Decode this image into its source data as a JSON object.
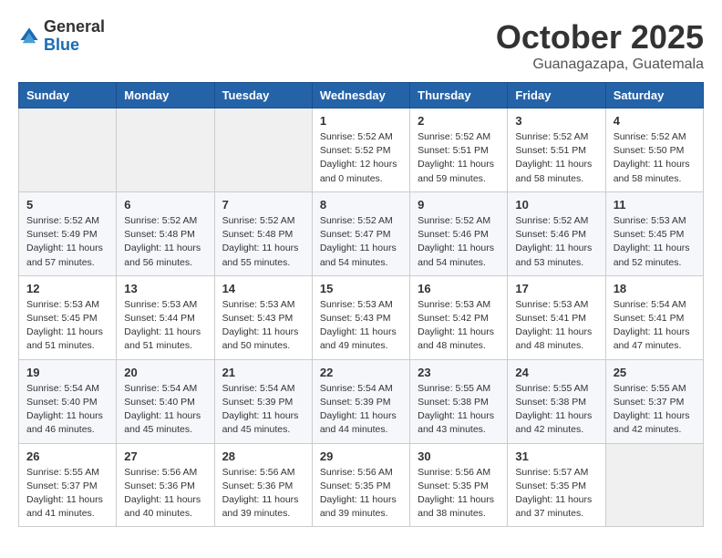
{
  "logo": {
    "general": "General",
    "blue": "Blue"
  },
  "title": "October 2025",
  "location": "Guanagazapa, Guatemala",
  "weekdays": [
    "Sunday",
    "Monday",
    "Tuesday",
    "Wednesday",
    "Thursday",
    "Friday",
    "Saturday"
  ],
  "weeks": [
    [
      {
        "day": "",
        "info": ""
      },
      {
        "day": "",
        "info": ""
      },
      {
        "day": "",
        "info": ""
      },
      {
        "day": "1",
        "info": "Sunrise: 5:52 AM\nSunset: 5:52 PM\nDaylight: 12 hours\nand 0 minutes."
      },
      {
        "day": "2",
        "info": "Sunrise: 5:52 AM\nSunset: 5:51 PM\nDaylight: 11 hours\nand 59 minutes."
      },
      {
        "day": "3",
        "info": "Sunrise: 5:52 AM\nSunset: 5:51 PM\nDaylight: 11 hours\nand 58 minutes."
      },
      {
        "day": "4",
        "info": "Sunrise: 5:52 AM\nSunset: 5:50 PM\nDaylight: 11 hours\nand 58 minutes."
      }
    ],
    [
      {
        "day": "5",
        "info": "Sunrise: 5:52 AM\nSunset: 5:49 PM\nDaylight: 11 hours\nand 57 minutes."
      },
      {
        "day": "6",
        "info": "Sunrise: 5:52 AM\nSunset: 5:48 PM\nDaylight: 11 hours\nand 56 minutes."
      },
      {
        "day": "7",
        "info": "Sunrise: 5:52 AM\nSunset: 5:48 PM\nDaylight: 11 hours\nand 55 minutes."
      },
      {
        "day": "8",
        "info": "Sunrise: 5:52 AM\nSunset: 5:47 PM\nDaylight: 11 hours\nand 54 minutes."
      },
      {
        "day": "9",
        "info": "Sunrise: 5:52 AM\nSunset: 5:46 PM\nDaylight: 11 hours\nand 54 minutes."
      },
      {
        "day": "10",
        "info": "Sunrise: 5:52 AM\nSunset: 5:46 PM\nDaylight: 11 hours\nand 53 minutes."
      },
      {
        "day": "11",
        "info": "Sunrise: 5:53 AM\nSunset: 5:45 PM\nDaylight: 11 hours\nand 52 minutes."
      }
    ],
    [
      {
        "day": "12",
        "info": "Sunrise: 5:53 AM\nSunset: 5:45 PM\nDaylight: 11 hours\nand 51 minutes."
      },
      {
        "day": "13",
        "info": "Sunrise: 5:53 AM\nSunset: 5:44 PM\nDaylight: 11 hours\nand 51 minutes."
      },
      {
        "day": "14",
        "info": "Sunrise: 5:53 AM\nSunset: 5:43 PM\nDaylight: 11 hours\nand 50 minutes."
      },
      {
        "day": "15",
        "info": "Sunrise: 5:53 AM\nSunset: 5:43 PM\nDaylight: 11 hours\nand 49 minutes."
      },
      {
        "day": "16",
        "info": "Sunrise: 5:53 AM\nSunset: 5:42 PM\nDaylight: 11 hours\nand 48 minutes."
      },
      {
        "day": "17",
        "info": "Sunrise: 5:53 AM\nSunset: 5:41 PM\nDaylight: 11 hours\nand 48 minutes."
      },
      {
        "day": "18",
        "info": "Sunrise: 5:54 AM\nSunset: 5:41 PM\nDaylight: 11 hours\nand 47 minutes."
      }
    ],
    [
      {
        "day": "19",
        "info": "Sunrise: 5:54 AM\nSunset: 5:40 PM\nDaylight: 11 hours\nand 46 minutes."
      },
      {
        "day": "20",
        "info": "Sunrise: 5:54 AM\nSunset: 5:40 PM\nDaylight: 11 hours\nand 45 minutes."
      },
      {
        "day": "21",
        "info": "Sunrise: 5:54 AM\nSunset: 5:39 PM\nDaylight: 11 hours\nand 45 minutes."
      },
      {
        "day": "22",
        "info": "Sunrise: 5:54 AM\nSunset: 5:39 PM\nDaylight: 11 hours\nand 44 minutes."
      },
      {
        "day": "23",
        "info": "Sunrise: 5:55 AM\nSunset: 5:38 PM\nDaylight: 11 hours\nand 43 minutes."
      },
      {
        "day": "24",
        "info": "Sunrise: 5:55 AM\nSunset: 5:38 PM\nDaylight: 11 hours\nand 42 minutes."
      },
      {
        "day": "25",
        "info": "Sunrise: 5:55 AM\nSunset: 5:37 PM\nDaylight: 11 hours\nand 42 minutes."
      }
    ],
    [
      {
        "day": "26",
        "info": "Sunrise: 5:55 AM\nSunset: 5:37 PM\nDaylight: 11 hours\nand 41 minutes."
      },
      {
        "day": "27",
        "info": "Sunrise: 5:56 AM\nSunset: 5:36 PM\nDaylight: 11 hours\nand 40 minutes."
      },
      {
        "day": "28",
        "info": "Sunrise: 5:56 AM\nSunset: 5:36 PM\nDaylight: 11 hours\nand 39 minutes."
      },
      {
        "day": "29",
        "info": "Sunrise: 5:56 AM\nSunset: 5:35 PM\nDaylight: 11 hours\nand 39 minutes."
      },
      {
        "day": "30",
        "info": "Sunrise: 5:56 AM\nSunset: 5:35 PM\nDaylight: 11 hours\nand 38 minutes."
      },
      {
        "day": "31",
        "info": "Sunrise: 5:57 AM\nSunset: 5:35 PM\nDaylight: 11 hours\nand 37 minutes."
      },
      {
        "day": "",
        "info": ""
      }
    ]
  ]
}
